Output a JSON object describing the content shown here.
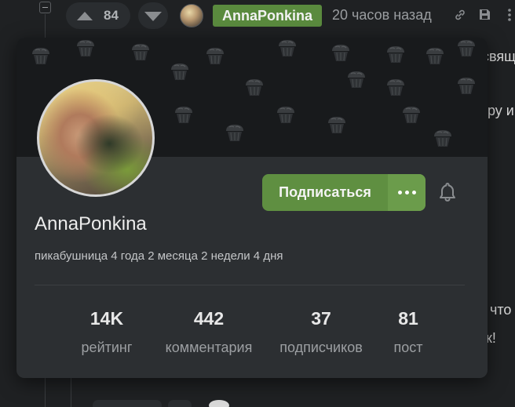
{
  "comment_header": {
    "vote_count": "84",
    "author": "AnnaPonkina",
    "timestamp": "20 часов назад"
  },
  "background_fragments": [
    "свящ",
    "ру и",
    "что",
    "к!"
  ],
  "profile_card": {
    "username": "AnnaPonkina",
    "tenure": "пикабушница 4 года 2 месяца 2 недели 4 дня",
    "subscribe_label": "Подписаться",
    "stats": [
      {
        "value": "14K",
        "label": "рейтинг"
      },
      {
        "value": "442",
        "label": "комментария"
      },
      {
        "value": "37",
        "label": "подписчиков"
      },
      {
        "value": "81",
        "label": "пост"
      }
    ]
  },
  "colors": {
    "accent_green": "#5f8f41",
    "author_badge": "#5a8a3e",
    "background": "#1f2123",
    "card": "#2c2f32"
  },
  "icons": [
    "collapse-icon",
    "upvote-icon",
    "downvote-icon",
    "link-icon",
    "save-icon",
    "more-vertical-icon",
    "bell-icon",
    "more-dots-icon",
    "cupcake-icon"
  ]
}
